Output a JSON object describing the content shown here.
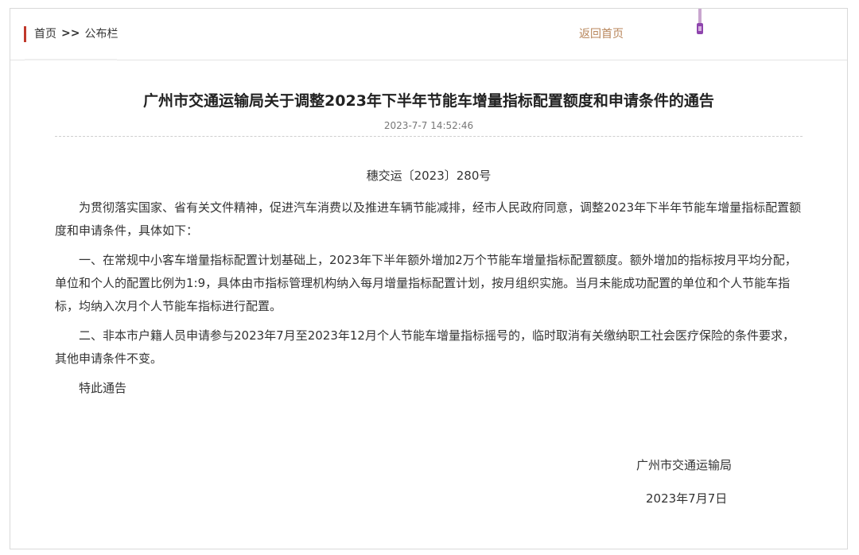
{
  "breadcrumb": {
    "home": "首页",
    "separator": ">>",
    "current": "公布栏"
  },
  "header": {
    "back_home": "返回首页"
  },
  "article": {
    "title": "广州市交通运输局关于调整2023年下半年节能车增量指标配置额度和申请条件的通告",
    "date": "2023-7-7 14:52:46",
    "doc_number": "穗交运〔2023〕280号",
    "paragraphs": [
      "为贯彻落实国家、省有关文件精神，促进汽车消费以及推进车辆节能减排，经市人民政府同意，调整2023年下半年节能车增量指标配置额度和申请条件，具体如下：",
      "一、在常规中小客车增量指标配置计划基础上，2023年下半年额外增加2万个节能车增量指标配置额度。额外增加的指标按月平均分配，单位和个人的配置比例为1:9，具体由市指标管理机构纳入每月增量指标配置计划，按月组织实施。当月未能成功配置的单位和个人节能车指标，均纳入次月个人节能车指标进行配置。",
      "二、非本市户籍人员申请参与2023年7月至2023年12月个人节能车增量指标摇号的，临时取消有关缴纳职工社会医疗保险的条件要求，其他申请条件不变。",
      "特此通告"
    ],
    "signature": "广州市交通运输局",
    "signature_date": "2023年7月7日"
  },
  "colors": {
    "accent": "#c0392b",
    "back_link": "#b8865b"
  }
}
